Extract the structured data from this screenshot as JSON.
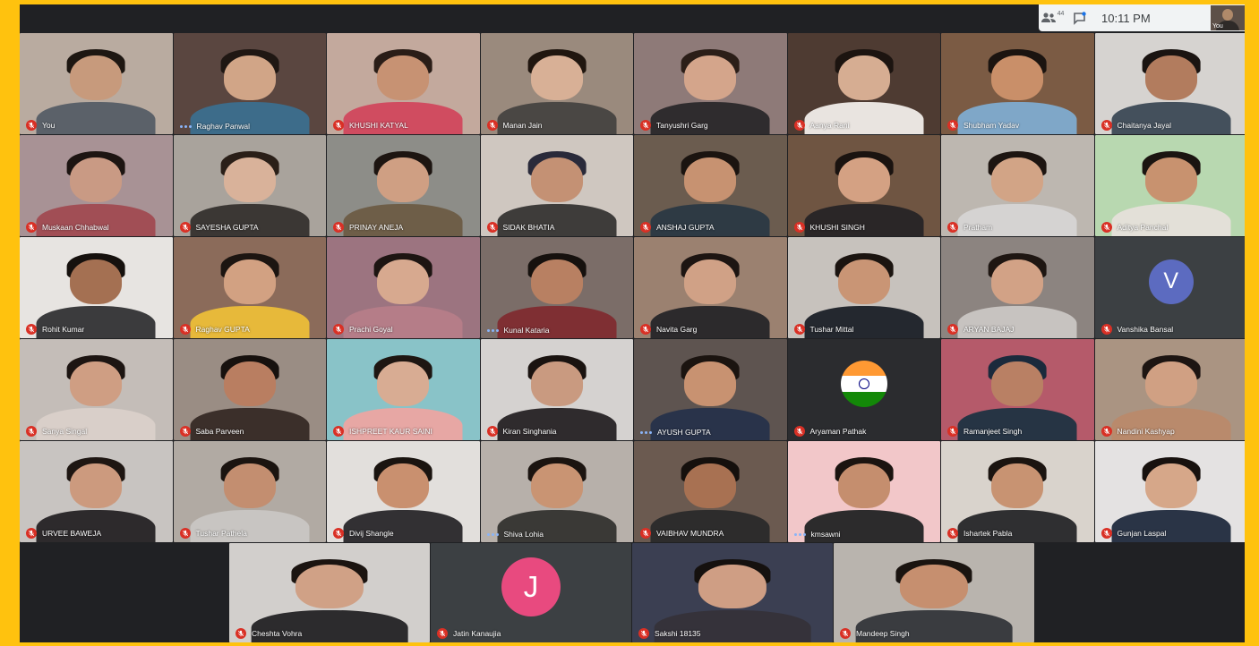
{
  "status_bar": {
    "time": "10:11 PM",
    "participants_count": "44",
    "self_label": "You",
    "icons": [
      "people-icon",
      "chat-icon"
    ]
  },
  "colors": {
    "frame": "#FFC20E",
    "meet_bg": "#202124",
    "mic_off": "#d93025",
    "speaking_dots": "#8ab4f8",
    "avatar_v": "#5c6bc0",
    "avatar_j": "#e84a7f"
  },
  "participants": [
    {
      "name": "You",
      "mic": "muted",
      "bg": "#b9aba0",
      "skin": "#c79a7c",
      "hair": "#1e1712",
      "shirt": "#5b6169"
    },
    {
      "name": "Raghav Panwal",
      "mic": "dots",
      "bg": "#5a4640",
      "skin": "#d1a587",
      "hair": "#1f1713",
      "shirt": "#3d6c8a"
    },
    {
      "name": "KHUSHI KATYAL",
      "mic": "muted",
      "bg": "#c3a99d",
      "skin": "#c79273",
      "hair": "#2a1d17",
      "shirt": "#d04c60"
    },
    {
      "name": "Manan Jain",
      "mic": "muted",
      "bg": "#9a8a7d",
      "skin": "#d8b096",
      "hair": "#20160f",
      "shirt": "#4a4744"
    },
    {
      "name": "Tanyushri Garg",
      "mic": "muted",
      "bg": "#8e7a78",
      "skin": "#d4a58b",
      "hair": "#2b1e18",
      "shirt": "#2f2c2e"
    },
    {
      "name": "Aanya Rani",
      "mic": "muted",
      "bg": "#4e3b32",
      "skin": "#d6ad92",
      "hair": "#1c1410",
      "shirt": "#e9e4e0"
    },
    {
      "name": "Shubham Yadav",
      "mic": "muted",
      "bg": "#7b5b44",
      "skin": "#c98f69",
      "hair": "#1b1410",
      "shirt": "#7fa7c8"
    },
    {
      "name": "Chaitanya Jayal",
      "mic": "muted",
      "bg": "#d6d3d0",
      "skin": "#b27c5e",
      "hair": "#1a1411",
      "shirt": "#44505c"
    },
    {
      "name": "Muskaan Chhabwal",
      "mic": "muted",
      "bg": "#a89295",
      "skin": "#c99a84",
      "hair": "#1d1512",
      "shirt": "#a14e55"
    },
    {
      "name": "SAYESHA GUPTA",
      "mic": "muted",
      "bg": "#a9a39c",
      "skin": "#d9b29a",
      "hair": "#2a1f18",
      "shirt": "#3b3734"
    },
    {
      "name": "PRINAY ANEJA",
      "mic": "muted",
      "bg": "#8d8d88",
      "skin": "#cf9f83",
      "hair": "#1d1511",
      "shirt": "#6e5e48"
    },
    {
      "name": "SIDAK BHATIA",
      "mic": "muted",
      "bg": "#cfc7c0",
      "skin": "#c49174",
      "hair": "#2a2a3a",
      "shirt": "#3e3c3a"
    },
    {
      "name": "ANSHAJ GUPTA",
      "mic": "muted",
      "bg": "#6b5c4f",
      "skin": "#c79271",
      "hair": "#1b1410",
      "shirt": "#2e3a44"
    },
    {
      "name": "KHUSHI SINGH",
      "mic": "muted",
      "bg": "#6f5542",
      "skin": "#d4a183",
      "hair": "#1a1310",
      "shirt": "#2a2627"
    },
    {
      "name": "Pratham",
      "mic": "muted",
      "bg": "#bdb7b0",
      "skin": "#d2a486",
      "hair": "#1d1511",
      "shirt": "#d5d3d2"
    },
    {
      "name": "Aditya Panchal",
      "mic": "muted",
      "bg": "#b8d8b0",
      "skin": "#c8926f",
      "hair": "#1b1511",
      "shirt": "#e3e0d8"
    },
    {
      "name": "Rohit Kumar",
      "mic": "muted",
      "bg": "#e7e4e1",
      "skin": "#a47052",
      "hair": "#16110e",
      "shirt": "#3b3b3d"
    },
    {
      "name": "Raghav GUPTA",
      "mic": "muted",
      "bg": "#8b6b5a",
      "skin": "#d2a182",
      "hair": "#1c1511",
      "shirt": "#e7b93a"
    },
    {
      "name": "Prachi Goyal",
      "mic": "muted",
      "bg": "#9c7480",
      "skin": "#d7a98f",
      "hair": "#1d1512",
      "shirt": "#b57d88"
    },
    {
      "name": "Kunal Kataria",
      "mic": "dots",
      "bg": "#7b6d68",
      "skin": "#b88062",
      "hair": "#16110e",
      "shirt": "#7f2f33"
    },
    {
      "name": "Navita Garg",
      "mic": "muted",
      "bg": "#9b8170",
      "skin": "#d0a186",
      "hair": "#1d1512",
      "shirt": "#2c2a2c"
    },
    {
      "name": "Tushar Mittal",
      "mic": "muted",
      "bg": "#c7c2bd",
      "skin": "#c99575",
      "hair": "#1b1410",
      "shirt": "#24282f"
    },
    {
      "name": "ARYAN BAJAJ",
      "mic": "muted",
      "bg": "#8c8480",
      "skin": "#d2a286",
      "hair": "#1e1612",
      "shirt": "#c7c3c0"
    },
    {
      "name": "Vanshika Bansal",
      "mic": "muted",
      "avatar": "V"
    },
    {
      "name": "Sanya Singal",
      "mic": "muted",
      "bg": "#c4bdb8",
      "skin": "#cf9e83",
      "hair": "#1d1512",
      "shirt": "#d9cfc9"
    },
    {
      "name": "Saba Parveen",
      "mic": "muted",
      "bg": "#9a8d84",
      "skin": "#b97e61",
      "hair": "#17110e",
      "shirt": "#3b2f2a"
    },
    {
      "name": "ISHPREET KAUR SAINI",
      "mic": "muted",
      "bg": "#89c3c8",
      "skin": "#d8ac93",
      "hair": "#1e1612",
      "shirt": "#e7a7a4"
    },
    {
      "name": "Kiran Singhania",
      "mic": "muted",
      "bg": "#d5d2d0",
      "skin": "#c99a80",
      "hair": "#1a1310",
      "shirt": "#2f2b2d"
    },
    {
      "name": "AYUSH GUPTA",
      "mic": "dots",
      "bg": "#5e5450",
      "skin": "#c89271",
      "hair": "#1b1410",
      "shirt": "#29334a"
    },
    {
      "name": "Aryaman Pathak",
      "mic": "muted",
      "flag": true
    },
    {
      "name": "Ramanjeet Singh",
      "mic": "muted",
      "bg": "#b55a6a",
      "skin": "#b98064",
      "hair": "#1b2a3c",
      "shirt": "#263444"
    },
    {
      "name": "Nandini Kashyap",
      "mic": "muted",
      "bg": "#aa9482",
      "skin": "#d0a083",
      "hair": "#1d1512",
      "shirt": "#b98a6c"
    },
    {
      "name": "URVEE BAWEJA",
      "mic": "muted",
      "bg": "#c8c4c1",
      "skin": "#cc9a7e",
      "hair": "#1e1612",
      "shirt": "#2d2a2c"
    },
    {
      "name": "Tushar Pathela",
      "mic": "muted",
      "bg": "#b1aaa3",
      "skin": "#c38e70",
      "hair": "#1b1410",
      "shirt": "#c8c5c2"
    },
    {
      "name": "Divij Shangle",
      "mic": "muted",
      "bg": "#e2dfdc",
      "skin": "#c9906f",
      "hair": "#1a1410",
      "shirt": "#323033"
    },
    {
      "name": "Shiva Lohia",
      "mic": "dots",
      "bg": "#b7b0aa",
      "skin": "#c99473",
      "hair": "#1b1410",
      "shirt": "#3a3936"
    },
    {
      "name": "VAIBHAV MUNDRA",
      "mic": "muted",
      "bg": "#6b5a50",
      "skin": "#a87152",
      "hair": "#15100d",
      "shirt": "#2d2c2c"
    },
    {
      "name": "kmsawni",
      "mic": "dots",
      "bg": "#f2c7c9",
      "skin": "#c58e6e",
      "hair": "#1b1410",
      "shirt": "#2c2b2c"
    },
    {
      "name": "Ishartek Pabla",
      "mic": "muted",
      "bg": "#d9d3cc",
      "skin": "#c89372",
      "hair": "#1b1410",
      "shirt": "#2f2f31"
    },
    {
      "name": "Gunjan Laspal",
      "mic": "muted",
      "bg": "#e4e2e2",
      "skin": "#d6a789",
      "hair": "#17110e",
      "shirt": "#2a3446"
    },
    {
      "name": "Cheshta Vohra",
      "mic": "muted",
      "bg": "#d2cfcc",
      "skin": "#d0a186",
      "hair": "#1b1410",
      "shirt": "#2c2b2d"
    },
    {
      "name": "Jatin Kanaujia",
      "mic": "muted",
      "avatar": "J"
    },
    {
      "name": "Sakshi 18135",
      "mic": "muted",
      "bg": "#3b3f52",
      "skin": "#cf9e84",
      "hair": "#15110f",
      "shirt": "#35323a"
    },
    {
      "name": "Mandeep Singh",
      "mic": "muted",
      "bg": "#b9b4ae",
      "skin": "#c68f6f",
      "hair": "#1a1410",
      "shirt": "#3a3c40"
    }
  ]
}
